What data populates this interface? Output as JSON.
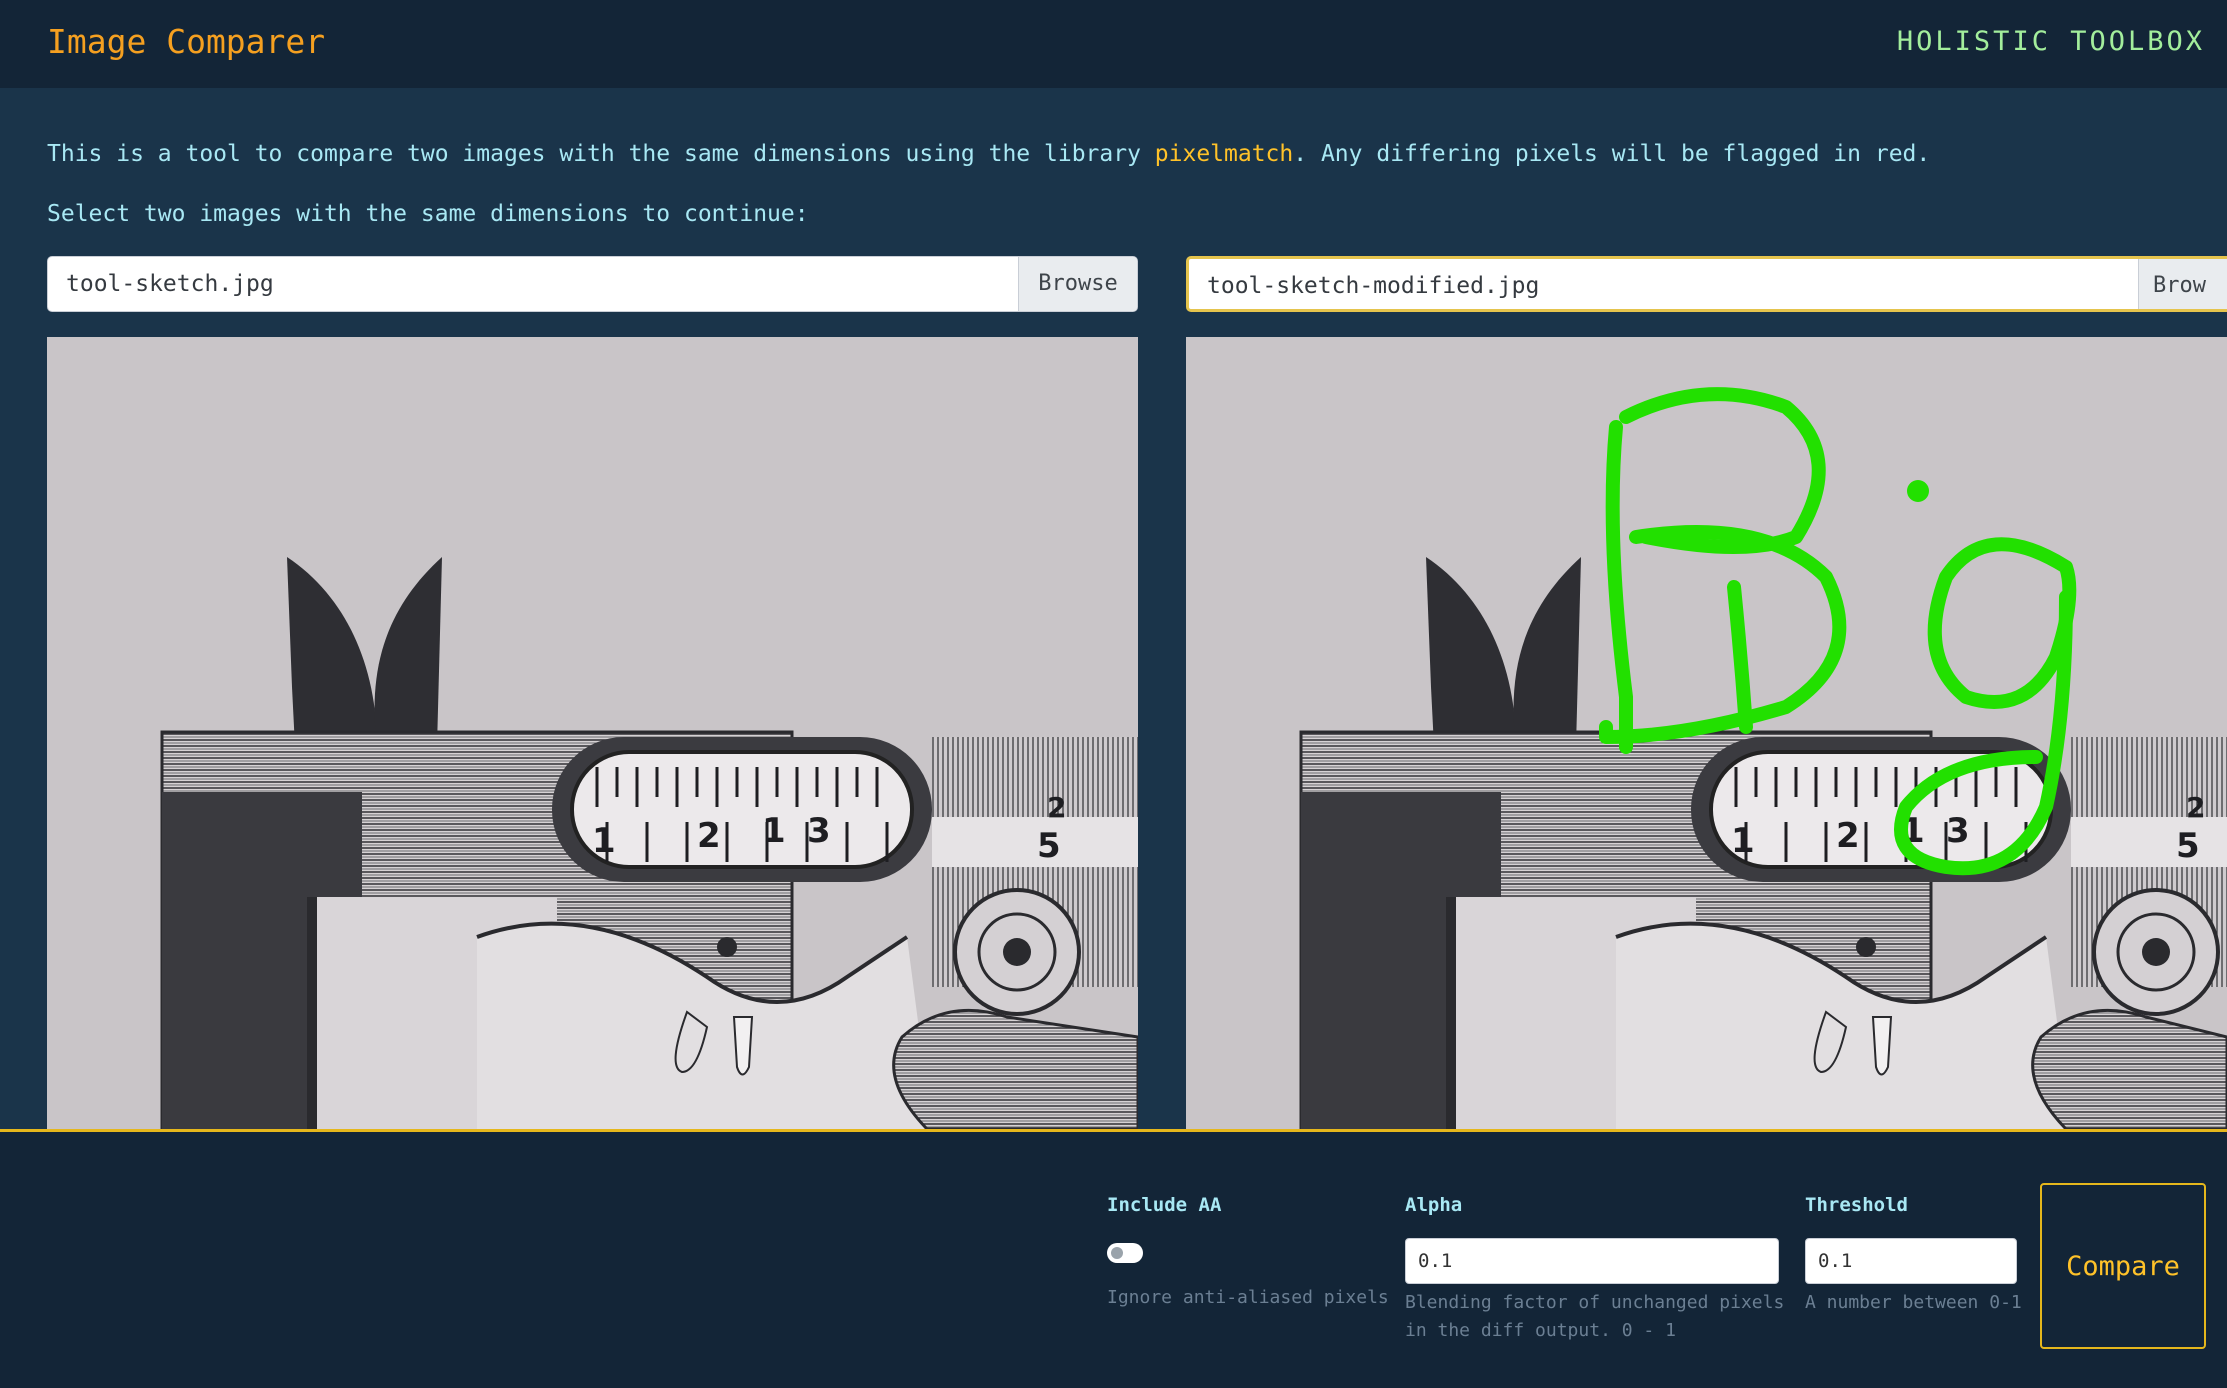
{
  "header": {
    "title": "Image Comparer",
    "brand": "HOLISTIC TOOLBOX"
  },
  "intro": {
    "text_before": "This is a tool to compare two images with the same dimensions using the library ",
    "link": "pixelmatch",
    "text_after": ". Any differing pixels will be flagged in red."
  },
  "select_prompt": "Select two images with the same dimensions to continue:",
  "left_file": {
    "name": "tool-sketch.jpg",
    "browse_label": "Browse"
  },
  "right_file": {
    "name": "tool-sketch-modified.jpg",
    "browse_label": "Brow"
  },
  "left_image": {
    "icon": "caliper-sketch-image"
  },
  "right_image": {
    "icon": "caliper-sketch-image",
    "overlay_text": "Big",
    "overlay_color": "#22e000"
  },
  "controls": {
    "include_aa": {
      "label": "Include AA",
      "help": "Ignore anti-aliased pixels",
      "enabled": false
    },
    "alpha": {
      "label": "Alpha",
      "value": "0.1",
      "help_line1": "Blending factor of unchanged pixels",
      "help_line2": "in the diff output. 0 - 1"
    },
    "threshold": {
      "label": "Threshold",
      "value": "0.1",
      "help": "A number between 0-1"
    },
    "compare_label": "Compare"
  },
  "colors": {
    "accent": "#f5a020",
    "brand": "#a3ee9c",
    "text": "#a8e8f4",
    "link": "#ffc229",
    "border_highlight": "#e5b71c"
  }
}
